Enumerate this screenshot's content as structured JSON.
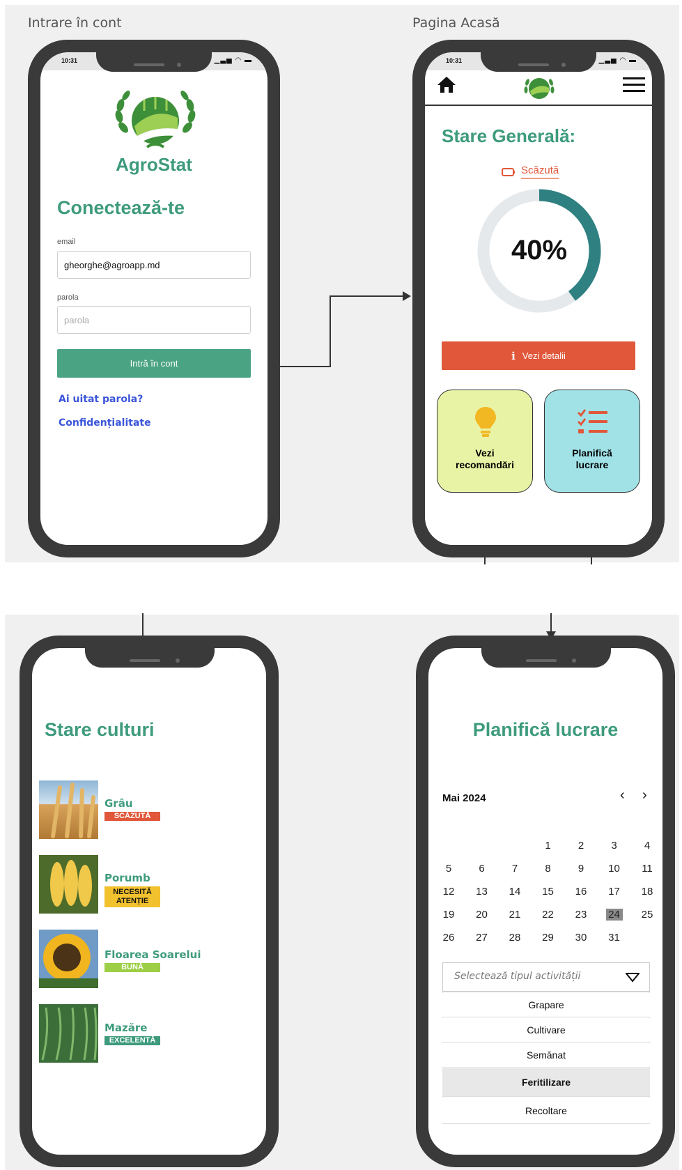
{
  "frames": {
    "login_title": "Intrare în cont",
    "home_title": "Pagina Acasă"
  },
  "status": {
    "time": "10:31",
    "icons": "▁▃▅ ◠ ▬"
  },
  "login": {
    "app_name": "AgroStat",
    "heading": "Conectează-te",
    "email_label": "email",
    "email_value": "gheorghe@agroapp.md",
    "password_label": "parola",
    "password_placeholder": "parola",
    "login_button": "Intră în cont",
    "forgot_link": "Ai uitat parola?",
    "privacy_link": "Confidențialitate"
  },
  "home": {
    "heading": "Stare Generală:",
    "status_label": "Scăzută",
    "progress_text": "40%",
    "progress_value": 0.4,
    "details_button": "Vezi detalii",
    "tile_recommend": "Vezi recomandări",
    "tile_plan": "Planifică lucrare"
  },
  "crops": {
    "heading": "Stare culturi",
    "items": [
      {
        "name": "Grâu",
        "status": "SCĂZUTĂ",
        "color": "#e0573a",
        "text_color": "#ffffff"
      },
      {
        "name": "Porumb",
        "status": "NECESITĂ ATENȚIE",
        "color": "#f2c12e",
        "text_color": "#111111"
      },
      {
        "name": "Floarea Soarelui",
        "status": "BUNĂ",
        "color": "#9ccf45",
        "text_color": "#ffffff"
      },
      {
        "name": "Mazăre",
        "status": "EXCELENTĂ",
        "color": "#3e9b7d",
        "text_color": "#ffffff"
      }
    ]
  },
  "planner": {
    "heading": "Planifică lucrare",
    "month": "Mai 2024",
    "prev": "‹",
    "next": "›",
    "weeks": [
      [
        "",
        "",
        "",
        "1",
        "2",
        "3",
        "4"
      ],
      [
        "5",
        "6",
        "7",
        "8",
        "9",
        "10",
        "11"
      ],
      [
        "12",
        "13",
        "14",
        "15",
        "16",
        "17",
        "18"
      ],
      [
        "19",
        "20",
        "21",
        "22",
        "23",
        "24",
        "25"
      ],
      [
        "26",
        "27",
        "28",
        "29",
        "30",
        "31",
        ""
      ]
    ],
    "selected_day": "24",
    "select_placeholder": "Selectează tipul activității",
    "options": [
      "Grapare",
      "Cultivare",
      "Semănat",
      "Feritilizare",
      "Recoltare"
    ],
    "highlighted_option": "Feritilizare"
  },
  "colors": {
    "brand_green": "#3e9b7d",
    "alert_red": "#e0573a",
    "ring_teal": "#2f8080",
    "tile_yellow": "#e9f3a6",
    "tile_cyan": "#a1e2e7"
  }
}
